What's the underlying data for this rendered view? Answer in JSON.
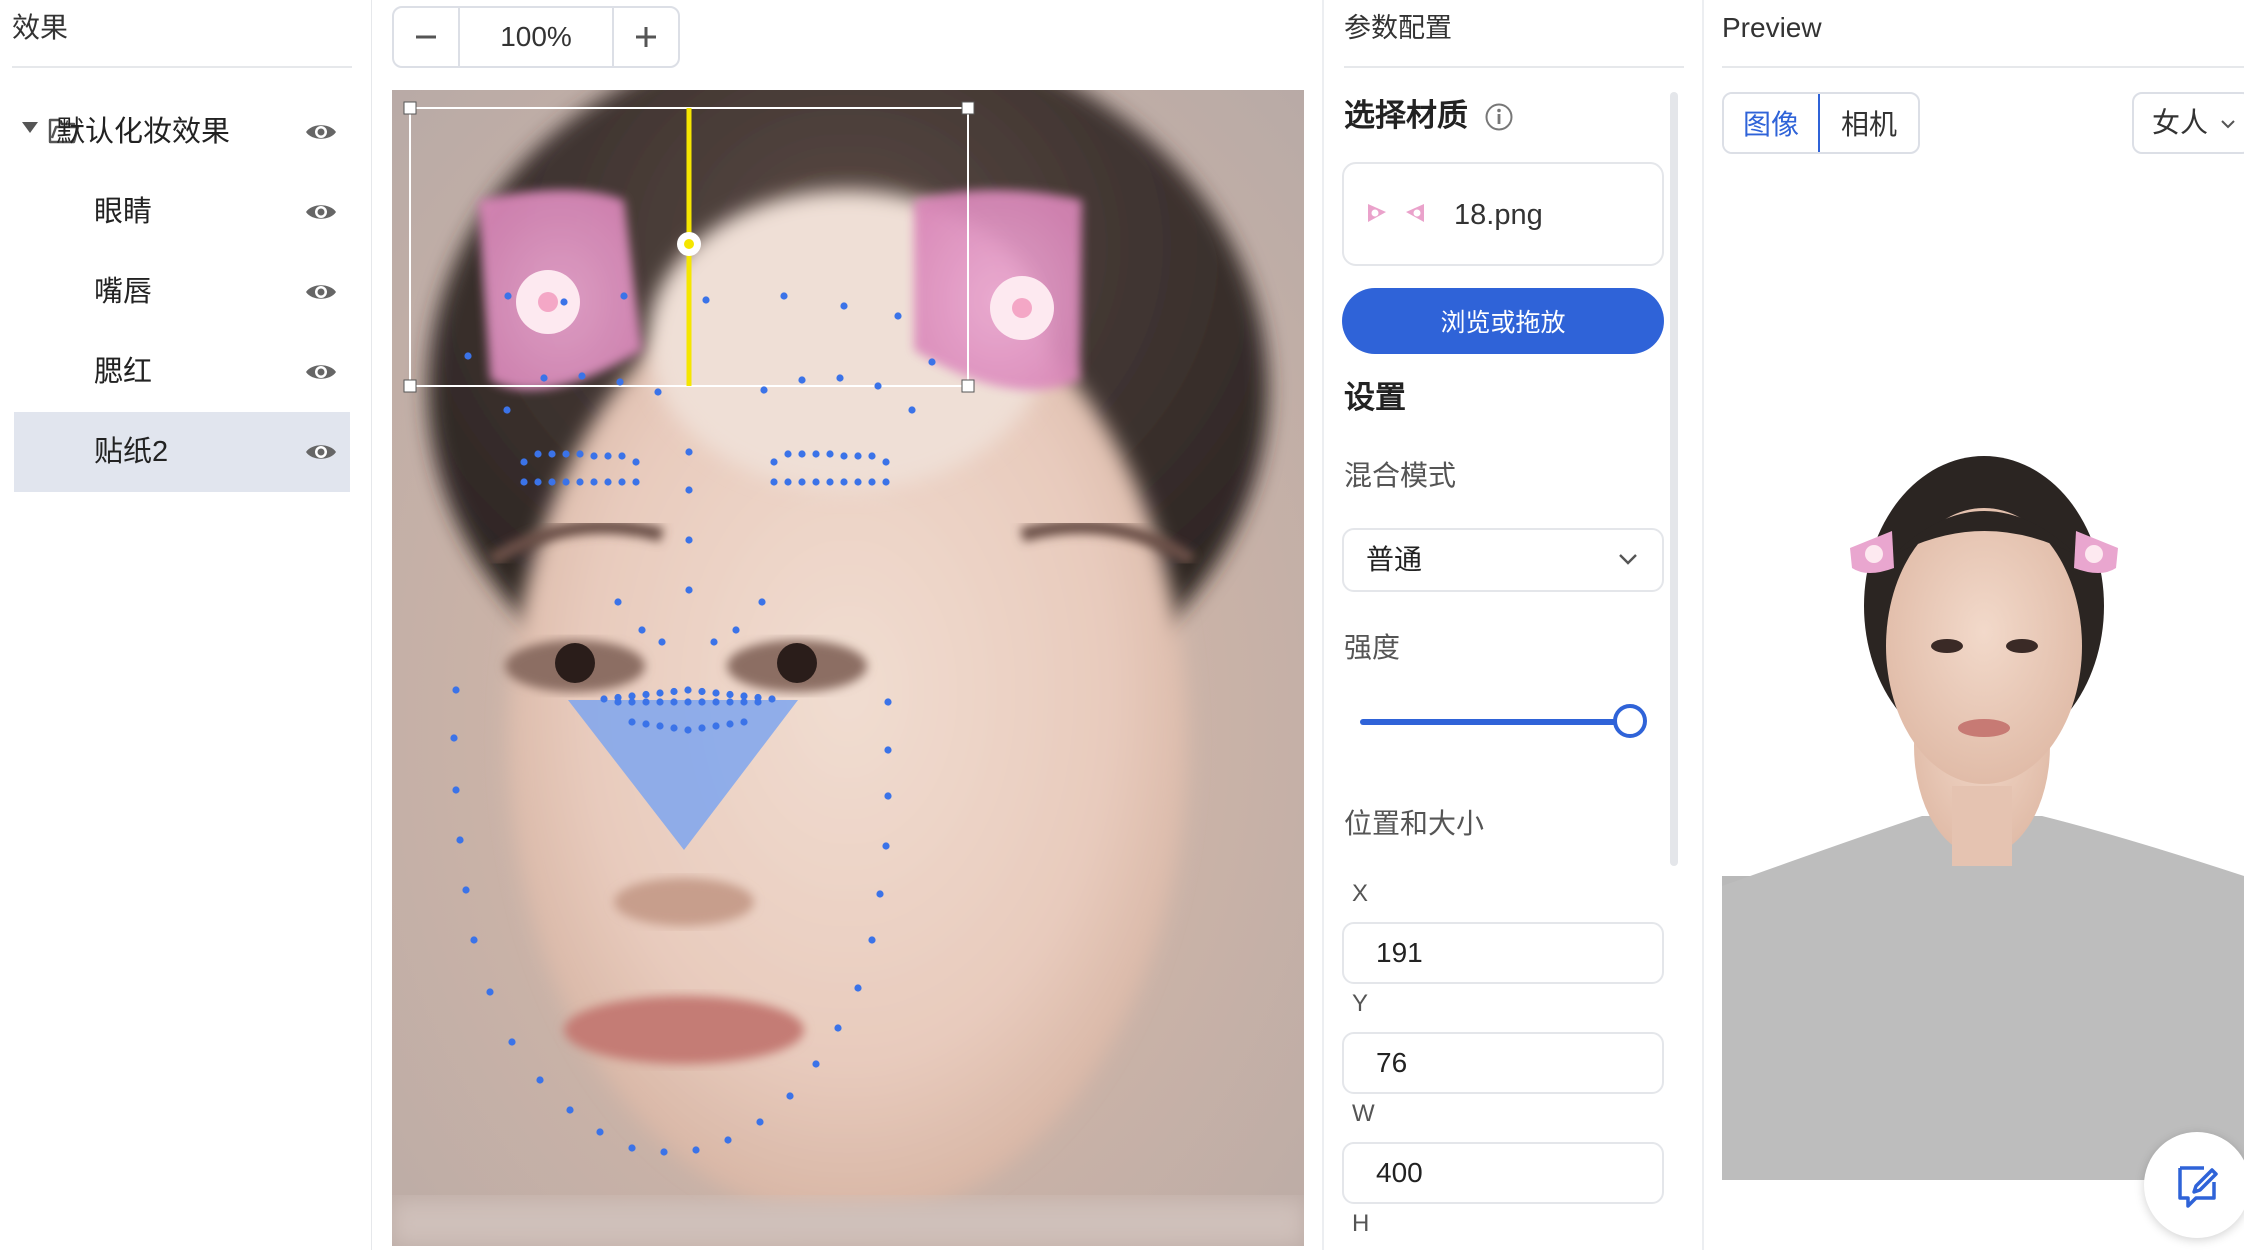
{
  "effects_panel": {
    "title": "效果",
    "tree": [
      {
        "label": "默认化妆效果",
        "group": true,
        "visible": true
      },
      {
        "label": "眼睛",
        "visible": true
      },
      {
        "label": "嘴唇",
        "visible": true
      },
      {
        "label": "腮红",
        "visible": true
      },
      {
        "label": "贴纸2",
        "visible": true,
        "selected": true
      }
    ]
  },
  "zoom": {
    "minus_icon": "minus-icon",
    "value": "100%",
    "plus_icon": "plus-icon"
  },
  "params": {
    "title": "参数配置",
    "material_title": "选择材质",
    "file_name": "18.png",
    "browse_label": "浏览或拖放",
    "settings_title": "设置",
    "blend_label": "混合模式",
    "blend_value": "普通",
    "strength_label": "强度",
    "strength_value": 1.0,
    "position_label": "位置和大小",
    "fields": [
      {
        "label": "X",
        "value": "191"
      },
      {
        "label": "Y",
        "value": "76"
      },
      {
        "label": "W",
        "value": "400"
      },
      {
        "label": "H",
        "value": ""
      }
    ]
  },
  "preview": {
    "title": "Preview",
    "tabs": [
      {
        "label": "图像",
        "active": true
      },
      {
        "label": "相机",
        "active": false
      }
    ],
    "model": "女人"
  },
  "colors": {
    "accent": "#2f63d8",
    "selected_row": "#e1e5ee",
    "landmark": "#3b73e8",
    "guide_line": "#f5e600"
  }
}
